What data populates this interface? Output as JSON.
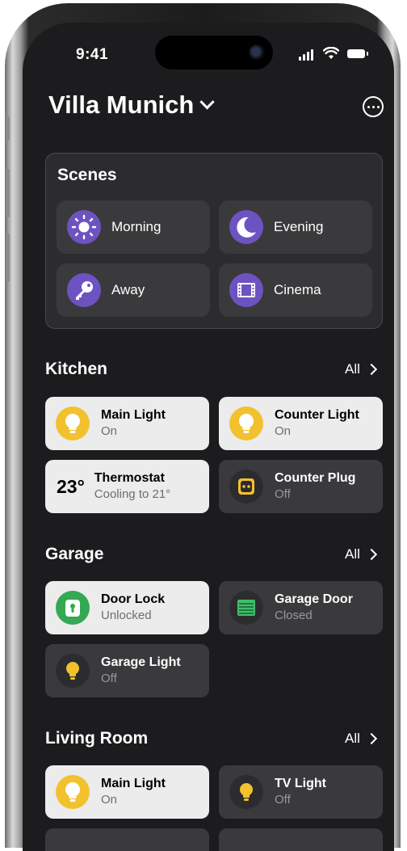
{
  "status_bar": {
    "time": "9:41"
  },
  "header": {
    "home_name": "Villa Munich"
  },
  "scenes": {
    "title": "Scenes",
    "items": [
      {
        "label": "Morning",
        "icon": "sun-icon"
      },
      {
        "label": "Evening",
        "icon": "moon-icon"
      },
      {
        "label": "Away",
        "icon": "key-icon"
      },
      {
        "label": "Cinema",
        "icon": "film-icon"
      }
    ]
  },
  "sections": [
    {
      "title": "Kitchen",
      "all_label": "All",
      "tiles": [
        {
          "name": "Main Light",
          "state": "On",
          "icon": "lightbulb-icon",
          "active": true
        },
        {
          "name": "Counter Light",
          "state": "On",
          "icon": "lightbulb-icon",
          "active": true
        },
        {
          "name": "Thermostat",
          "state": "Cooling to 21°",
          "temperature": "23°",
          "active": true
        },
        {
          "name": "Counter Plug",
          "state": "Off",
          "icon": "outlet-icon",
          "active": false
        }
      ]
    },
    {
      "title": "Garage",
      "all_label": "All",
      "tiles": [
        {
          "name": "Door Lock",
          "state": "Unlocked",
          "icon": "lock-icon",
          "active": true
        },
        {
          "name": "Garage Door",
          "state": "Closed",
          "icon": "garage-door-icon",
          "active": false
        },
        {
          "name": "Garage Light",
          "state": "Off",
          "icon": "lightbulb-icon",
          "active": false
        }
      ]
    },
    {
      "title": "Living Room",
      "all_label": "All",
      "tiles": [
        {
          "name": "Main Light",
          "state": "On",
          "icon": "lightbulb-icon",
          "active": true
        },
        {
          "name": "TV Light",
          "state": "Off",
          "icon": "lightbulb-icon",
          "active": false
        }
      ]
    }
  ],
  "colors": {
    "background": "#1c1c1e",
    "card": "#2c2c2e",
    "tile_off": "#3a3a3c",
    "tile_on": "#ececec",
    "scene_accent": "#6d53c1",
    "light_yellow": "#f2c12e",
    "lock_green": "#34a853",
    "garage_green": "#3fbf6a"
  }
}
